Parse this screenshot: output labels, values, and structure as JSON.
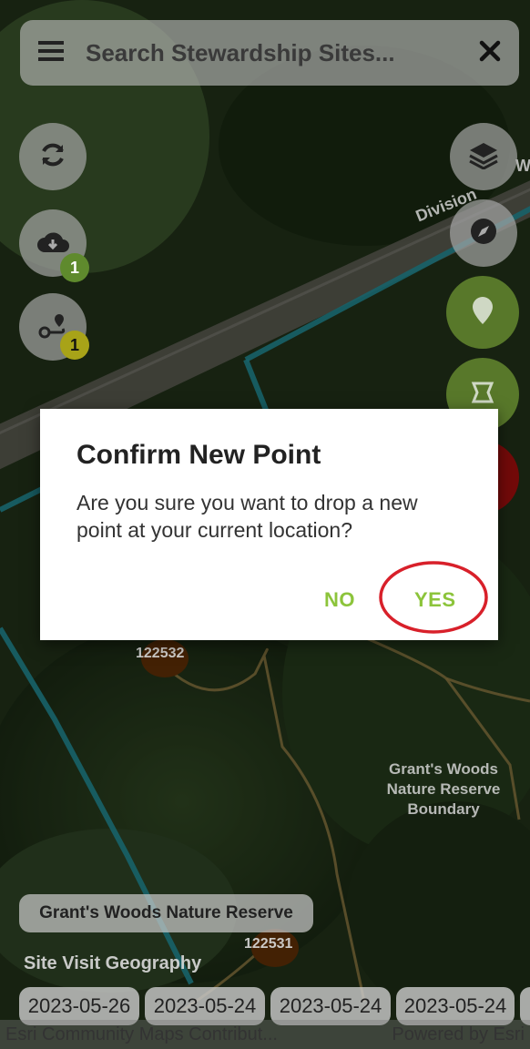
{
  "search": {
    "placeholder": "Search Stewardship Sites..."
  },
  "icons": {
    "menu": "menu-icon",
    "close": "close-icon",
    "sync": "sync-icon",
    "download": "cloud-download-icon",
    "route": "route-icon",
    "layers": "layers-icon",
    "compass": "compass-icon",
    "location": "location-pin-icon",
    "polygon": "polygon-icon"
  },
  "badges": {
    "download_count": "1",
    "route_count": "1"
  },
  "map_labels": {
    "road": "Division",
    "road_suffix": "W",
    "boundary_line1": "Grant's Woods",
    "boundary_line2": "Nature Reserve",
    "boundary_line3": "Boundary",
    "marker_top": "122532",
    "marker_bottom": "122531"
  },
  "dialog": {
    "title": "Confirm New Point",
    "message": "Are you sure you want to drop a new point at your current location?",
    "no_label": "NO",
    "yes_label": "YES"
  },
  "site_chip": "Grant's Woods Nature Reserve",
  "layer_label": "Site Visit Geography",
  "dates": [
    "2023-05-26",
    "2023-05-24",
    "2023-05-24",
    "2023-05-24"
  ],
  "attribution": {
    "left": "Esri Community Maps Contribut...",
    "right": "Powered by Esri"
  },
  "colors": {
    "accent_green": "#8cc43b",
    "annotation_red": "#d8202a",
    "boundary_cyan": "#2bb3c0"
  }
}
